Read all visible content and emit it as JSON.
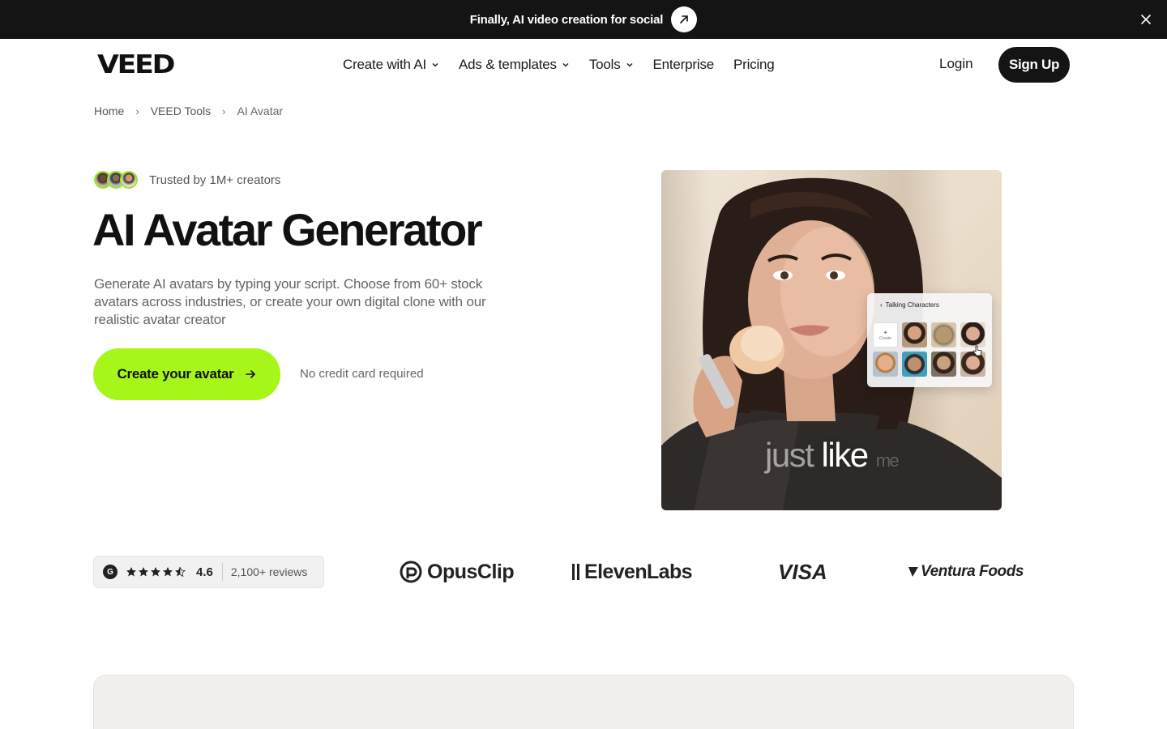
{
  "announcement": {
    "text": "Finally, AI video creation for social"
  },
  "nav": {
    "logo": "VEED",
    "menu": [
      {
        "label": "Create with AI",
        "dropdown": true
      },
      {
        "label": "Ads & templates",
        "dropdown": true
      },
      {
        "label": "Tools",
        "dropdown": true
      },
      {
        "label": "Enterprise",
        "dropdown": false
      },
      {
        "label": "Pricing",
        "dropdown": false
      }
    ],
    "login": "Login",
    "signup": "Sign Up"
  },
  "breadcrumb": [
    "Home",
    "VEED Tools",
    "AI Avatar"
  ],
  "hero": {
    "trusted": "Trusted by 1M+ creators",
    "title": "AI Avatar Generator",
    "description": "Generate AI avatars by typing your script. Choose from 60+ stock avatars across industries, or create your own digital clone with our realistic avatar creator",
    "cta": "Create your avatar",
    "no_credit_card": "No credit card required"
  },
  "hero_image": {
    "caption_parts": [
      "just",
      "like",
      "me"
    ],
    "panel_title": "Talking Characters",
    "panel_create": "Create"
  },
  "rating": {
    "score": "4.6",
    "reviews": "2,100+ reviews"
  },
  "brands": [
    "OpusClip",
    "ElevenLabs",
    "VISA",
    "Ventura Foods"
  ],
  "colors": {
    "accent_green": "#a6f619",
    "dark": "#141414"
  }
}
